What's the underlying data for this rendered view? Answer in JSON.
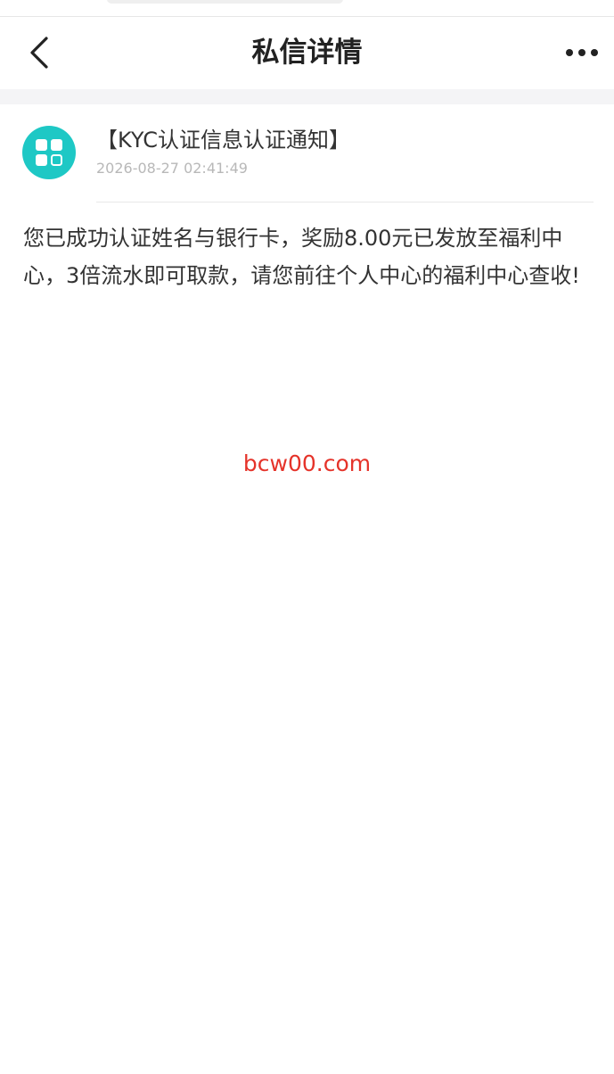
{
  "nav": {
    "title": "私信详情"
  },
  "icons": {
    "back": "chevron-left-icon",
    "more": "more-horizontal-icon",
    "avatar": "app-grid-icon"
  },
  "colors": {
    "avatar_bg": "#1ec8c5",
    "watermark": "#e5332a"
  },
  "message": {
    "title": "【KYC认证信息认证通知】",
    "time": "2026-08-27 02:41:49",
    "body": "您已成功认证姓名与银行卡，奖励8.00元已发放至福利中心，3倍流水即可取款，请您前往个人中心的福利中心查收!"
  },
  "watermark": {
    "text": "bcw00.com"
  }
}
